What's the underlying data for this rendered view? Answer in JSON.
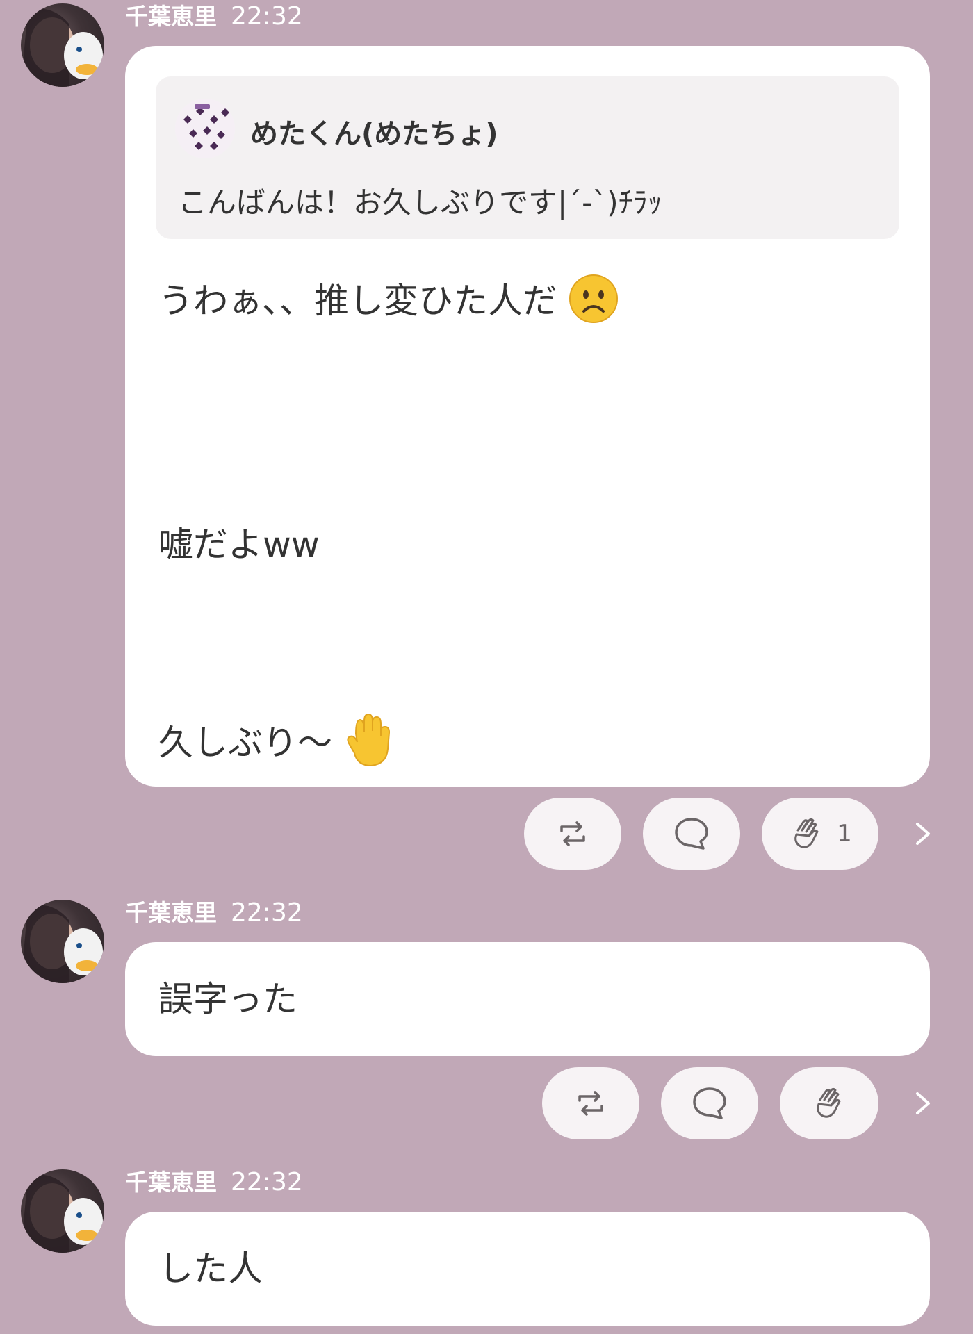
{
  "messages": [
    {
      "sender": "千葉恵里",
      "time": "22:32",
      "quote": {
        "name": "めたくん(めたちょ)",
        "text": "こんばんは！お久しぶりです|´-`)ﾁﾗｯ"
      },
      "lines": [
        "うわぁ、、推し変ひた人だ",
        "嘘だよww",
        "久しぶり〜"
      ],
      "emojis": [
        "frowning-face",
        "raised-hand"
      ],
      "actions": {
        "clap_count": "1"
      }
    },
    {
      "sender": "千葉恵里",
      "time": "22:32",
      "text": "誤字った"
    },
    {
      "sender": "千葉恵里",
      "time": "22:32",
      "text": "した人"
    }
  ],
  "colors": {
    "background": "#c1a8b7",
    "bubble": "#ffffff",
    "quote_bg": "#f3f1f2",
    "action_pill": "#f7f3f5"
  },
  "icons": [
    "repost-icon",
    "comment-icon",
    "clap-icon",
    "chevron-right-icon"
  ]
}
